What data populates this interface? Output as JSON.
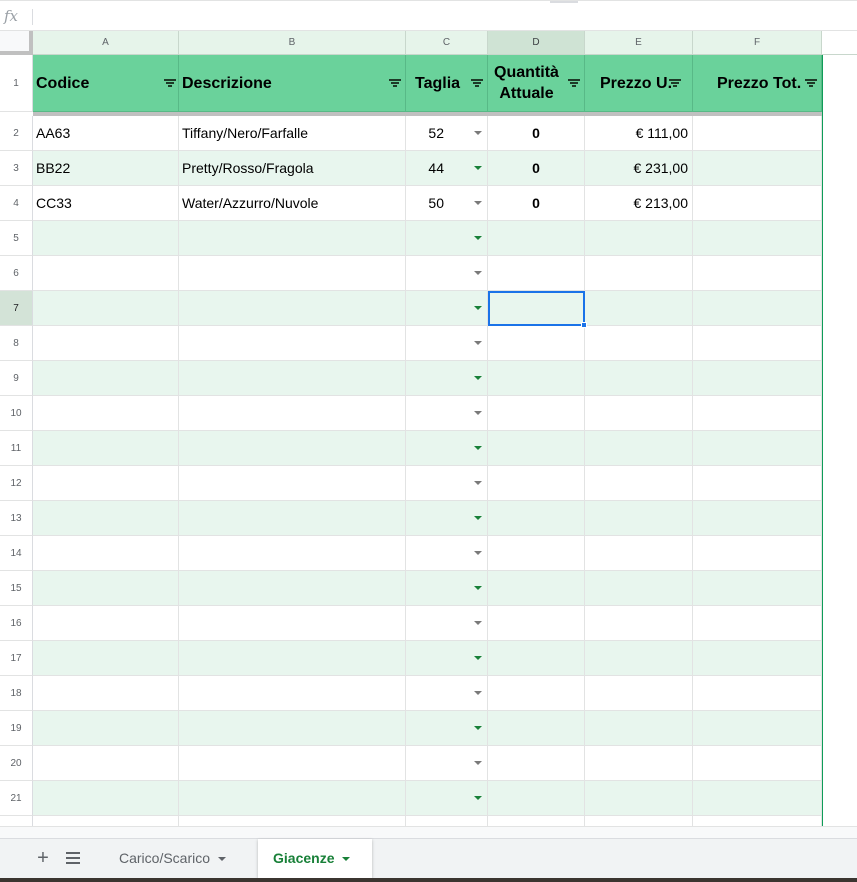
{
  "formula_bar": {
    "fx_label": "fx",
    "value": ""
  },
  "columns": [
    "A",
    "B",
    "C",
    "D",
    "E",
    "F"
  ],
  "selected_column": "D",
  "header_row": {
    "codice": "Codice",
    "descrizione": "Descrizione",
    "taglia": "Taglia",
    "quantita_line1": "Quantità",
    "quantita_line2": "Attuale",
    "prezzo_u": "Prezzo U.",
    "prezzo_tot": "Prezzo Tot."
  },
  "rows": [
    {
      "codice": "AA63",
      "descrizione": "Tiffany/Nero/Farfalle",
      "taglia": "52",
      "quantita": "0",
      "prezzo_u": "€ 111,00",
      "prezzo_tot": ""
    },
    {
      "codice": "BB22",
      "descrizione": "Pretty/Rosso/Fragola",
      "taglia": "44",
      "quantita": "0",
      "prezzo_u": "€ 231,00",
      "prezzo_tot": ""
    },
    {
      "codice": "CC33",
      "descrizione": "Water/Azzurro/Nuvole",
      "taglia": "50",
      "quantita": "0",
      "prezzo_u": "€ 213,00",
      "prezzo_tot": ""
    }
  ],
  "row_numbers": [
    "1",
    "2",
    "3",
    "4",
    "5",
    "6",
    "7",
    "8",
    "9",
    "10",
    "11",
    "12",
    "13",
    "14",
    "15",
    "16",
    "17",
    "18",
    "19",
    "20",
    "21"
  ],
  "selected_row": "7",
  "sheets": [
    {
      "name": "Carico/Scarico",
      "active": false
    },
    {
      "name": "Giacenze",
      "active": true
    }
  ],
  "colors": {
    "header_green": "#6ad29b",
    "band_green": "#e8f6ee",
    "selection_blue": "#1a73e8",
    "tab_green": "#188038"
  },
  "icons": {
    "add_sheet": "plus-icon",
    "all_sheets": "list-icon",
    "filter": "filter-icon",
    "dropdown": "dropdown-arrow-icon"
  }
}
